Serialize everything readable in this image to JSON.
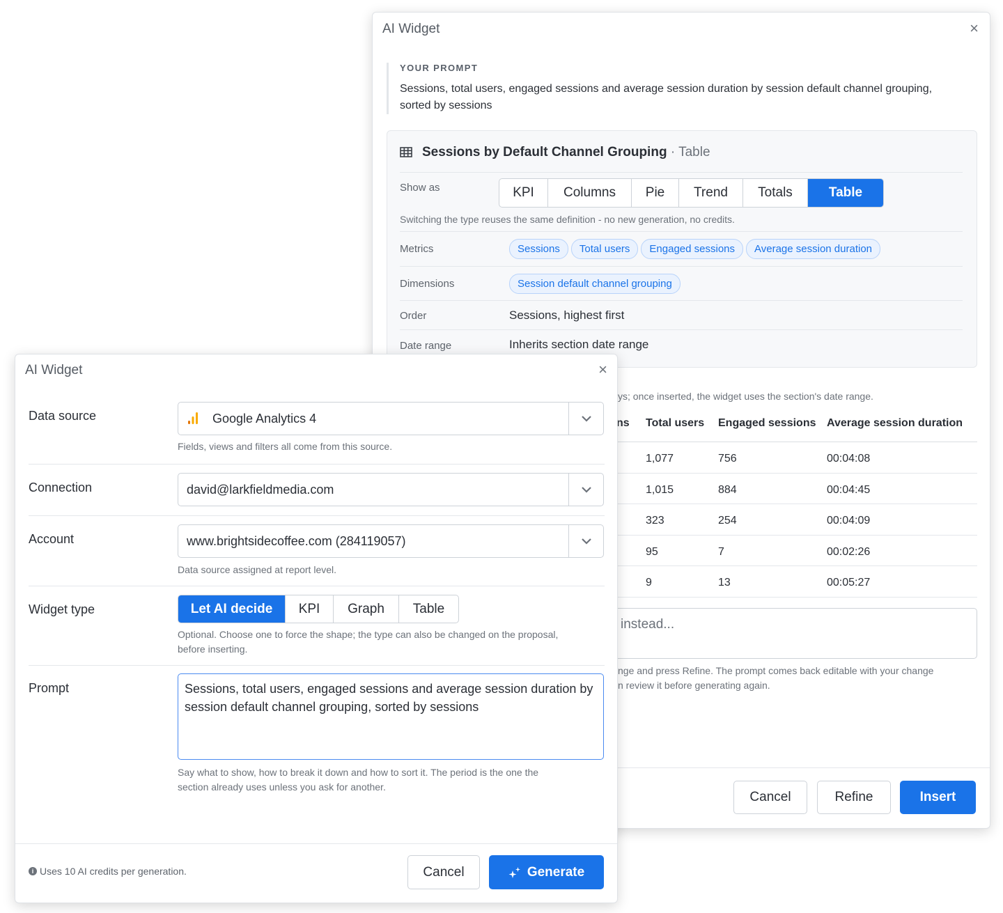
{
  "proposal_modal": {
    "title": "AI Widget",
    "close_icon": "×",
    "prompt_caption": "YOUR PROMPT",
    "prompt_text": "Sessions, total users, engaged sessions and average session duration by session default channel grouping, sorted by sessions",
    "proposal": {
      "icon": "table-grid-icon",
      "title": "Sessions by Default Channel Grouping",
      "type_suffix": "· Table",
      "show_as_label": "Show as",
      "show_as_options": [
        "KPI",
        "Columns",
        "Pie",
        "Trend",
        "Totals",
        "Table"
      ],
      "show_as_selected": "Table",
      "show_as_hint": "Switching the type reuses the same definition - no new generation, no credits.",
      "metrics_label": "Metrics",
      "metrics": [
        "Sessions",
        "Total users",
        "Engaged sessions",
        "Average session duration"
      ],
      "dimensions_label": "Dimensions",
      "dimensions": [
        "Session default channel grouping"
      ],
      "order_label": "Order",
      "order_value": "Sessions, highest first",
      "date_range_label": "Date range",
      "date_range_value": "Inherits section date range"
    },
    "preview_note": "ys; once inserted, the widget uses the section's date range.",
    "table": {
      "columns": [
        "ns",
        "Total users",
        "Engaged sessions",
        "Average session duration"
      ],
      "rows": [
        [
          "1,077",
          "756",
          "00:04:08"
        ],
        [
          "1,015",
          "884",
          "00:04:45"
        ],
        [
          "323",
          "254",
          "00:04:09"
        ],
        [
          "95",
          "7",
          "00:02:26"
        ],
        [
          "9",
          "13",
          "00:05:27"
        ]
      ]
    },
    "refine_placeholder": "instead...",
    "refine_hint_line1": "nge and press Refine. The prompt comes back editable with your change",
    "refine_hint_line2": "n review it before generating again.",
    "buttons": {
      "cancel": "Cancel",
      "refine": "Refine",
      "insert": "Insert"
    }
  },
  "generate_modal": {
    "title": "AI Widget",
    "close_icon": "×",
    "data_source": {
      "label": "Data source",
      "value": "Google Analytics 4",
      "icon": "google-analytics-icon",
      "hint": "Fields, views and filters all come from this source."
    },
    "connection": {
      "label": "Connection",
      "value": "david@larkfieldmedia.com"
    },
    "account": {
      "label": "Account",
      "value": "www.brightsidecoffee.com (284119057)",
      "hint": "Data source assigned at report level."
    },
    "widget_type": {
      "label": "Widget type",
      "options": [
        "Let AI decide",
        "KPI",
        "Graph",
        "Table"
      ],
      "selected": "Let AI decide",
      "hint_line1": "Optional. Choose one to force the shape; the type can also be changed on the proposal,",
      "hint_line2": "before inserting."
    },
    "prompt": {
      "label": "Prompt",
      "value": "Sessions, total users, engaged sessions and average session duration by session default channel grouping, sorted by sessions",
      "hint_line1": "Say what to show, how to break it down and how to sort it. The period is the one the",
      "hint_line2": "section already uses unless you ask for another."
    },
    "credits_note": "Uses 10 AI credits per generation.",
    "buttons": {
      "cancel": "Cancel",
      "generate": "Generate"
    }
  },
  "colors": {
    "accent": "#1a73e8",
    "analytics_orange": "#f9ab00",
    "analytics_dark": "#e37400"
  }
}
